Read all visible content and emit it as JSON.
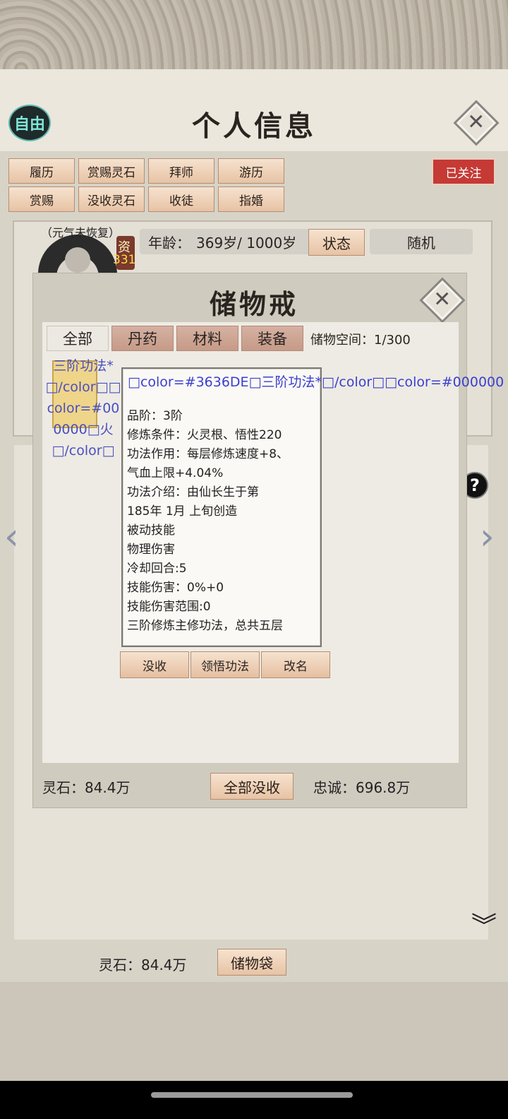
{
  "header": {
    "free_label": "自由",
    "title": "个人信息",
    "close_symbol": "✕"
  },
  "actions": {
    "row1": [
      "履历",
      "赏赐灵石",
      "拜师",
      "游历"
    ],
    "row2": [
      "赏赐",
      "没收灵石",
      "收徒",
      "指婚"
    ],
    "followed": "已关注"
  },
  "profile": {
    "status_note": "（元气未恢复）",
    "talent_label": "资",
    "talent_value": "331",
    "age_label": "年龄：",
    "age_value": "369岁/ 1000岁",
    "state_button": "状态",
    "random_label": "随机"
  },
  "storage": {
    "title": "储物戒",
    "close_symbol": "✕",
    "tabs": [
      "全部",
      "丹药",
      "材料",
      "装备"
    ],
    "capacity_label": "储物空间：1/300",
    "item_name": "三阶功法*□/color□□color=#000000□火□/color□",
    "tooltip": {
      "title": "□color=#3636DE□三阶功法*□/color□□color=#000000",
      "lines": [
        "品阶：3阶",
        "修炼条件：火灵根、悟性220",
        "功法作用：每层修炼速度+8、",
        "气血上限+4.04%",
        "功法介绍：由仙长生于第",
        "185年 1月 上旬创造",
        "被动技能",
        "物理伤害",
        "冷却回合:5",
        "技能伤害：0%+0",
        "技能伤害范围:0",
        "三阶修炼主修功法，总共五层"
      ]
    },
    "buttons": [
      "没收",
      "领悟功法",
      "改名"
    ],
    "spirit_stone": "灵石：84.4万",
    "confiscate_all": "全部没收",
    "loyalty": "忠诚：696.8万"
  },
  "footer": {
    "spirit_stone": "灵石：84.4万",
    "bag_button": "储物袋"
  },
  "icons": {
    "help": "?",
    "left_arrow": "‹",
    "right_arrow": "›",
    "scroll_down": "︾"
  }
}
